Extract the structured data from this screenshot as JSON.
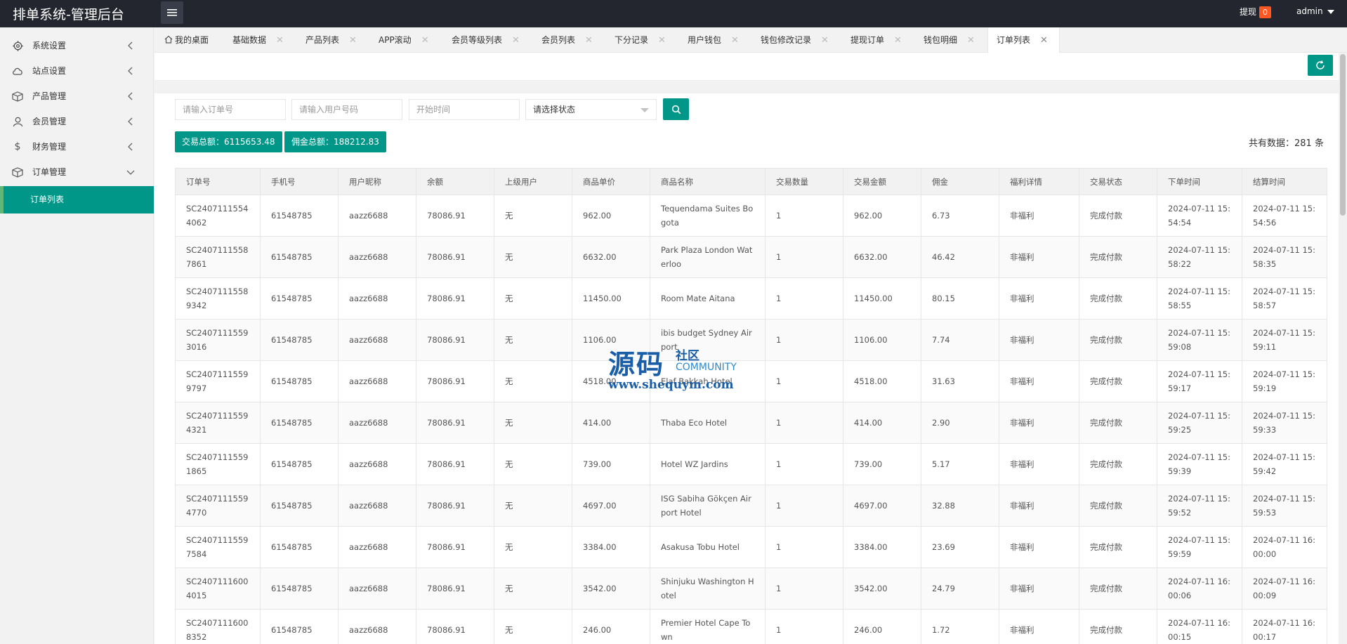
{
  "app": {
    "title": "排单系统-管理后台",
    "withdraw_label": "提现",
    "withdraw_count": "0",
    "user": "admin"
  },
  "colors": {
    "accent": "#009688",
    "topbar": "#23262e",
    "badge": "#ff5722"
  },
  "sidebar": {
    "items": [
      {
        "label": "系统设置",
        "icon": "gear-icon"
      },
      {
        "label": "站点设置",
        "icon": "cloud-icon"
      },
      {
        "label": "产品管理",
        "icon": "box-icon"
      },
      {
        "label": "会员管理",
        "icon": "user-icon"
      },
      {
        "label": "财务管理",
        "icon": "dollar-icon"
      },
      {
        "label": "订单管理",
        "icon": "box-icon"
      }
    ],
    "active_sub": "订单列表"
  },
  "tabs": [
    {
      "label": "我的桌面",
      "icon": "home-icon"
    },
    {
      "label": "基础数据"
    },
    {
      "label": "产品列表"
    },
    {
      "label": "APP滚动"
    },
    {
      "label": "会员等级列表"
    },
    {
      "label": "会员列表"
    },
    {
      "label": "下分记录"
    },
    {
      "label": "用户钱包"
    },
    {
      "label": "钱包修改记录"
    },
    {
      "label": "提现订单"
    },
    {
      "label": "钱包明细"
    },
    {
      "label": "订单列表",
      "active": true
    }
  ],
  "filters": {
    "order_placeholder": "请输入订单号",
    "phone_placeholder": "请输入用户号码",
    "start_placeholder": "开始时间",
    "status_label": "请选择状态"
  },
  "stats": {
    "trade_total": "交易总额：6115653.48",
    "commission_total": "佣金总额：188212.83",
    "record_count": "共有数据：281 条"
  },
  "table": {
    "headers": [
      "订单号",
      "手机号",
      "用户昵称",
      "余额",
      "上级用户",
      "商品单价",
      "商品名称",
      "交易数量",
      "交易金额",
      "佣金",
      "福利详情",
      "交易状态",
      "下单时间",
      "结算时间"
    ],
    "rows": [
      [
        "SC24071115544062",
        "61548785",
        "aazz6688",
        "78086.91",
        "无",
        "962.00",
        "Tequendama Suites Bogota",
        "1",
        "962.00",
        "6.73",
        "非福利",
        "完成付款",
        "2024-07-11 15:54:54",
        "2024-07-11 15:54:56"
      ],
      [
        "SC24071115587861",
        "61548785",
        "aazz6688",
        "78086.91",
        "无",
        "6632.00",
        "Park Plaza London Waterloo",
        "1",
        "6632.00",
        "46.42",
        "非福利",
        "完成付款",
        "2024-07-11 15:58:22",
        "2024-07-11 15:58:35"
      ],
      [
        "SC24071115589342",
        "61548785",
        "aazz6688",
        "78086.91",
        "无",
        "11450.00",
        "Room Mate Aitana",
        "1",
        "11450.00",
        "80.15",
        "非福利",
        "完成付款",
        "2024-07-11 15:58:55",
        "2024-07-11 15:58:57"
      ],
      [
        "SC24071115593016",
        "61548785",
        "aazz6688",
        "78086.91",
        "无",
        "1106.00",
        "ibis budget Sydney Airport",
        "1",
        "1106.00",
        "7.74",
        "非福利",
        "完成付款",
        "2024-07-11 15:59:08",
        "2024-07-11 15:59:11"
      ],
      [
        "SC24071115599797",
        "61548785",
        "aazz6688",
        "78086.91",
        "无",
        "4518.00",
        "Elaf Bakkah Hotel",
        "1",
        "4518.00",
        "31.63",
        "非福利",
        "完成付款",
        "2024-07-11 15:59:17",
        "2024-07-11 15:59:19"
      ],
      [
        "SC24071115594321",
        "61548785",
        "aazz6688",
        "78086.91",
        "无",
        "414.00",
        "Thaba Eco Hotel",
        "1",
        "414.00",
        "2.90",
        "非福利",
        "完成付款",
        "2024-07-11 15:59:25",
        "2024-07-11 15:59:33"
      ],
      [
        "SC24071115591865",
        "61548785",
        "aazz6688",
        "78086.91",
        "无",
        "739.00",
        "Hotel WZ Jardins",
        "1",
        "739.00",
        "5.17",
        "非福利",
        "完成付款",
        "2024-07-11 15:59:39",
        "2024-07-11 15:59:42"
      ],
      [
        "SC24071115594770",
        "61548785",
        "aazz6688",
        "78086.91",
        "无",
        "4697.00",
        "ISG Sabiha Gökçen Airport Hotel",
        "1",
        "4697.00",
        "32.88",
        "非福利",
        "完成付款",
        "2024-07-11 15:59:52",
        "2024-07-11 15:59:53"
      ],
      [
        "SC24071115597584",
        "61548785",
        "aazz6688",
        "78086.91",
        "无",
        "3384.00",
        "Asakusa Tobu Hotel",
        "1",
        "3384.00",
        "23.69",
        "非福利",
        "完成付款",
        "2024-07-11 15:59:59",
        "2024-07-11 16:00:00"
      ],
      [
        "SC24071116004015",
        "61548785",
        "aazz6688",
        "78086.91",
        "无",
        "3542.00",
        "Shinjuku Washington Hotel",
        "1",
        "3542.00",
        "24.79",
        "非福利",
        "完成付款",
        "2024-07-11 16:00:06",
        "2024-07-11 16:00:09"
      ],
      [
        "SC24071116008352",
        "61548785",
        "aazz6688",
        "78086.91",
        "无",
        "246.00",
        "Premier Hotel Cape Town",
        "1",
        "246.00",
        "1.72",
        "非福利",
        "完成付款",
        "2024-07-11 16:00:15",
        "2024-07-11 16:00:17"
      ]
    ]
  },
  "watermark": {
    "big": "源码",
    "small": "社区",
    "en": "COMMUNITY",
    "url": "www.shequym.com"
  }
}
